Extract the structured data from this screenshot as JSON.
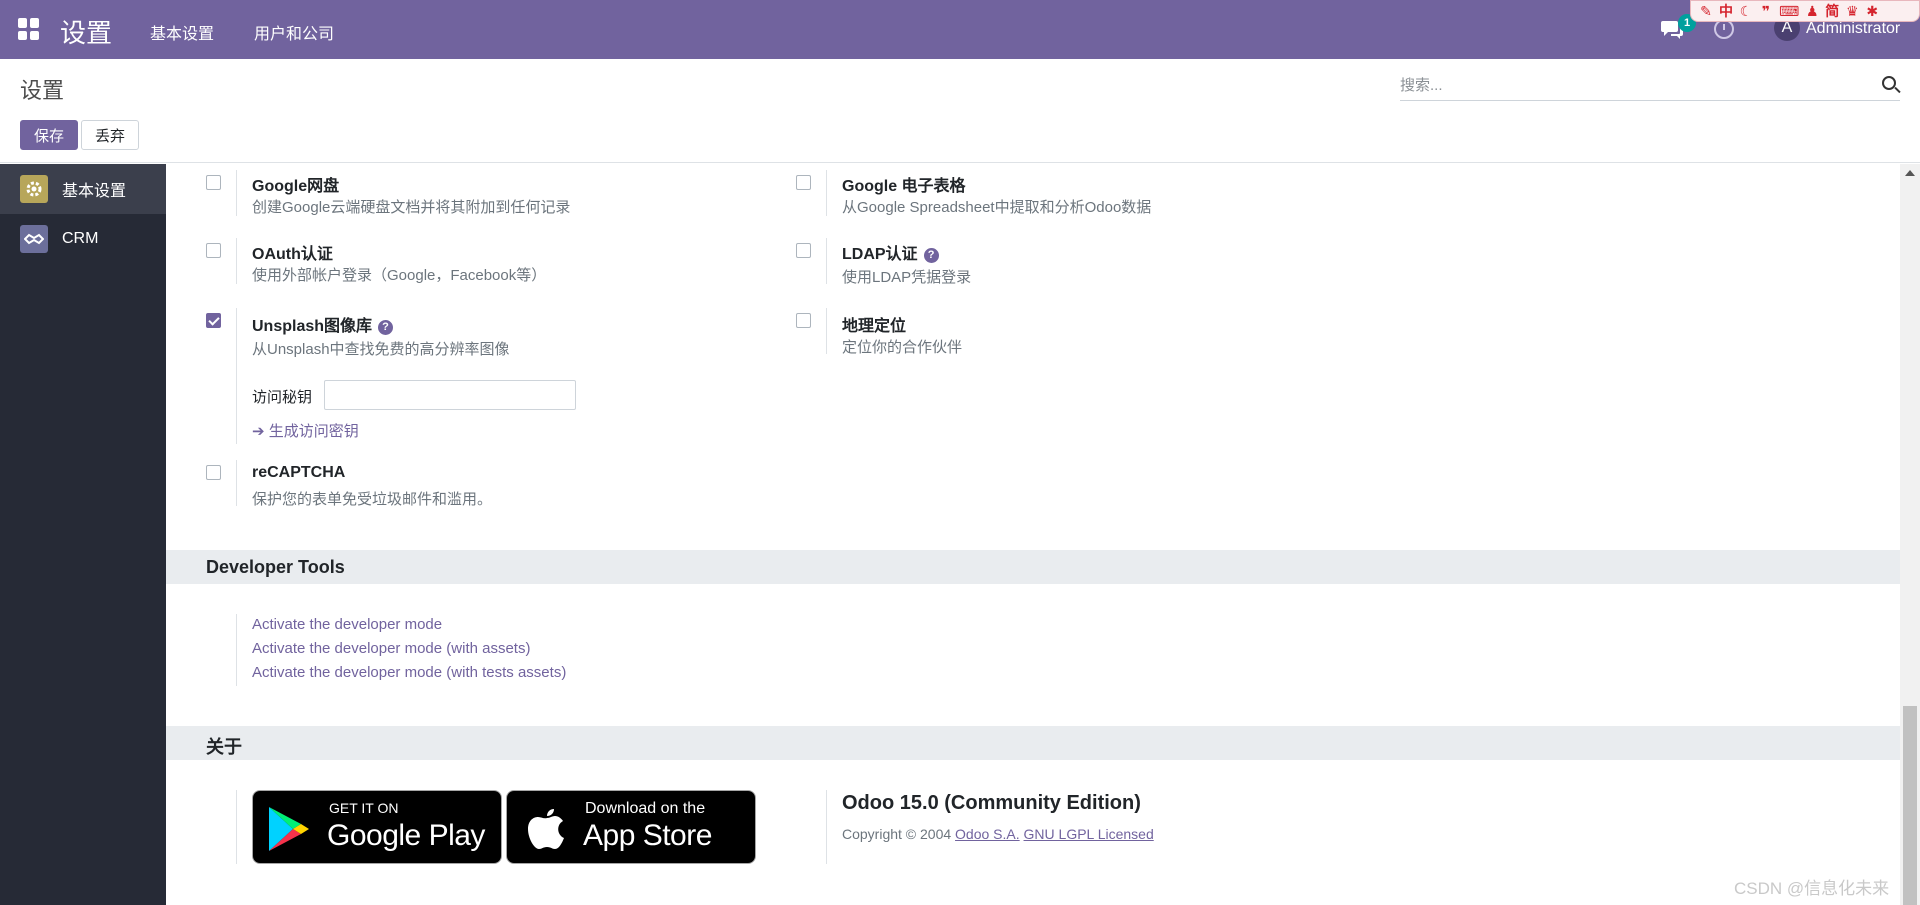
{
  "topbar": {
    "brand": "设置",
    "menu": [
      "基本设置",
      "用户和公司"
    ],
    "chat_badge": "1",
    "user_initial": "A",
    "user_name": "Administrator",
    "extension_glyphs": [
      "中",
      "♪",
      "简"
    ]
  },
  "control_panel": {
    "breadcrumb": "设置",
    "search_placeholder": "搜索...",
    "save_label": "保存",
    "discard_label": "丢弃"
  },
  "sidebar": {
    "items": [
      {
        "label": "基本设置",
        "icon": "gear-icon",
        "active": true
      },
      {
        "label": "CRM",
        "icon": "handshake-icon",
        "active": false
      }
    ]
  },
  "integrations": {
    "google_drive": {
      "title": "Google网盘",
      "desc": "创建Google云端硬盘文档并将其附加到任何记录",
      "checked": false
    },
    "google_sheets": {
      "title": "Google 电子表格",
      "desc": "从Google Spreadsheet中提取和分析Odoo数据",
      "checked": false
    },
    "oauth": {
      "title": "OAuth认证",
      "desc": "使用外部帐户登录（Google，Facebook等）",
      "checked": false
    },
    "ldap": {
      "title": "LDAP认证",
      "desc": "使用LDAP凭据登录",
      "checked": false
    },
    "unsplash": {
      "title": "Unsplash图像库",
      "desc": "从Unsplash中查找免费的高分辨率图像",
      "checked": true,
      "access_key_label": "访问秘钥",
      "access_key_value": "",
      "generate_link": "生成访问密钥"
    },
    "geolocation": {
      "title": "地理定位",
      "desc": "定位你的合作伙伴",
      "checked": false
    },
    "recaptcha": {
      "title": "reCAPTCHA",
      "desc": "保护您的表单免受垃圾邮件和滥用。",
      "checked": false
    }
  },
  "developer_tools": {
    "heading": "Developer Tools",
    "links": [
      "Activate the developer mode",
      "Activate the developer mode (with assets)",
      "Activate the developer mode (with tests assets)"
    ]
  },
  "about": {
    "heading": "关于",
    "google_play_small": "GET IT ON",
    "google_play_big": "Google Play",
    "app_store_small": "Download on the",
    "app_store_big": "App Store",
    "version": "Odoo 15.0 (Community Edition)",
    "copyright_prefix": "Copyright © 2004",
    "company_link": "Odoo S.A.",
    "license_link": "GNU LGPL Licensed"
  },
  "watermark": "CSDN @信息化未来",
  "colors": {
    "brand": "#71639e",
    "sidebar": "#262a36",
    "section": "#e9ecef"
  }
}
